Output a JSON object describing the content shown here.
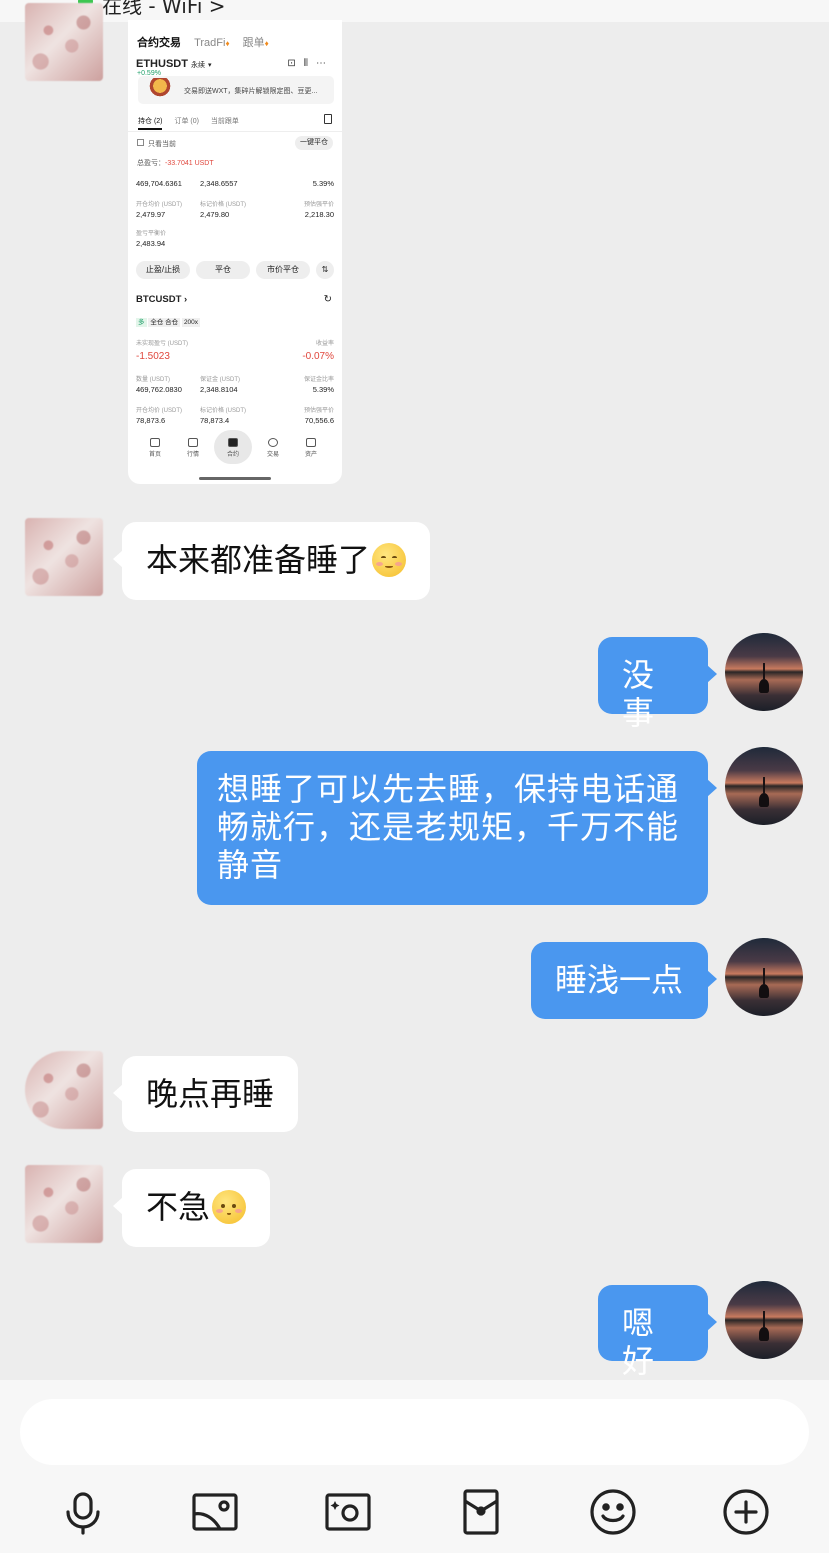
{
  "chat_header": {
    "status_text": "在线 - WiFi >"
  },
  "shared_screenshot": {
    "tabs": [
      "合约交易",
      "TradFi",
      "跟单"
    ],
    "symbol": "ETHUSDT",
    "symbol_type": "永续",
    "change": "+0.59%",
    "banner_text": "交易即送WXT，集碎片解锁限定图、豆更...",
    "position_tabs": [
      "持仓 (2)",
      "订单 (0)",
      "当前跟单"
    ],
    "only_current_label": "只看当前",
    "close_all_label": "一键平仓",
    "total_pnl_label": "总盈亏：",
    "total_pnl_value": "-33.7041 USDT",
    "eth_position": {
      "row1": [
        "469,704.6361",
        "2,348.6557",
        "5.39%"
      ],
      "labels2": [
        "开仓均价 (USDT)",
        "标记价格 (USDT)",
        "预估强平价"
      ],
      "row2": [
        "2,479.97",
        "2,479.80",
        "2,218.30"
      ],
      "breakeven_label": "盈亏平衡价",
      "breakeven_value": "2,483.94",
      "buttons": [
        "止盈/止损",
        "平仓",
        "市价平仓"
      ]
    },
    "btc_position": {
      "symbol": "BTCUSDT",
      "direction": "多",
      "mode": "全仓 合仓",
      "leverage": "200x",
      "unrealized_label": "未实现盈亏 (USDT)",
      "unrealized_value": "-1.5023",
      "roe_label": "收益率",
      "roe_value": "-0.07%",
      "labels_a": [
        "数量 (USDT)",
        "保证金 (USDT)",
        "保证金比率"
      ],
      "values_a": [
        "469,762.0830",
        "2,348.8104",
        "5.39%"
      ],
      "labels_b": [
        "开仓均价 (USDT)",
        "标记价格 (USDT)",
        "预估强平价"
      ],
      "values_b": [
        "78,873.6",
        "78,873.4",
        "70,556.6"
      ]
    },
    "bottom_nav": [
      "首页",
      "行情",
      "合约",
      "交易",
      "资产"
    ]
  },
  "messages": [
    {
      "side": "left",
      "text": "本来都准备睡了",
      "emoji": "pleading-emoji"
    },
    {
      "side": "right",
      "text": "没事"
    },
    {
      "side": "right",
      "text": "想睡了可以先去睡，保持电话通畅就行，还是老规矩，千万不能静音"
    },
    {
      "side": "right",
      "text": "睡浅一点"
    },
    {
      "side": "left",
      "text": "晚点再睡"
    },
    {
      "side": "left",
      "text": "不急",
      "emoji": "shy-emoji"
    },
    {
      "side": "right",
      "text": "嗯好"
    }
  ],
  "input": {
    "value": "",
    "tools": [
      "microphone-icon",
      "image-icon",
      "camera-icon",
      "red-packet-icon",
      "emoji-icon",
      "plus-icon"
    ]
  },
  "colors": {
    "background": "#ededed",
    "outgoing_bubble": "#4a97ef",
    "incoming_bubble": "#ffffff",
    "loss_red": "#e0473d",
    "online_green": "#3ec651"
  }
}
